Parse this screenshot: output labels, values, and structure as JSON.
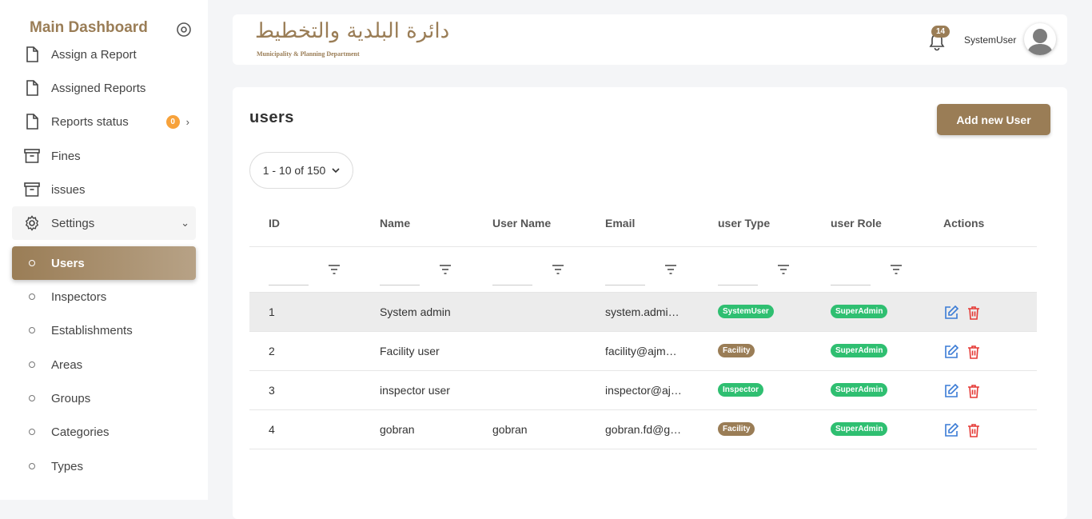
{
  "sidebar": {
    "brand": "Main Dashboard",
    "items": [
      {
        "label": "Assign a Report",
        "icon": "file-icon"
      },
      {
        "label": "Assigned Reports",
        "icon": "file-icon"
      },
      {
        "label": "Reports status",
        "icon": "file-icon",
        "badge": "0"
      },
      {
        "label": "Fines",
        "icon": "archive-icon"
      },
      {
        "label": "issues",
        "icon": "archive-icon"
      },
      {
        "label": "Settings",
        "icon": "gear-icon"
      }
    ],
    "subitems": [
      "Users",
      "Inspectors",
      "Establishments",
      "Areas",
      "Groups",
      "Categories",
      "Types"
    ]
  },
  "topbar": {
    "logo_arabic": "دائرة البلدية والتخطيط",
    "logo_english": "Municipality & Planning Department",
    "notification_count": "14",
    "username": "SystemUser"
  },
  "main": {
    "title": "users",
    "add_button": "Add new User",
    "pager": "1 - 10 of 150",
    "columns": [
      "ID",
      "Name",
      "User Name",
      "Email",
      "user Type",
      "user Role",
      "Actions"
    ],
    "rows": [
      {
        "id": "1",
        "name": "System admin",
        "username": "",
        "email": "system.admi…",
        "type": "SystemUser",
        "role": "SuperAdmin"
      },
      {
        "id": "2",
        "name": "Facility user",
        "username": "",
        "email": "facility@ajm…",
        "type": "Facility",
        "role": "SuperAdmin"
      },
      {
        "id": "3",
        "name": "inspector user",
        "username": "",
        "email": "inspector@aj…",
        "type": "Inspector",
        "role": "SuperAdmin"
      },
      {
        "id": "4",
        "name": "gobran",
        "username": "gobran",
        "email": "gobran.fd@g…",
        "type": "Facility",
        "role": "SuperAdmin"
      }
    ]
  },
  "colors": {
    "brand": "#9a7d56",
    "green": "#2fbf71",
    "badge_orange": "#f7a23b",
    "edit_blue": "#3a7bd5",
    "delete_red": "#e53935"
  }
}
